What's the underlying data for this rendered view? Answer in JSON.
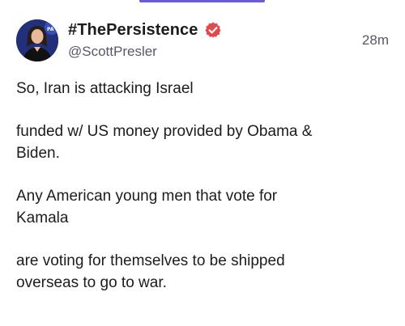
{
  "post": {
    "author": {
      "display_name": "#ThePersistence",
      "handle": "@ScottPresler",
      "verified": true,
      "avatar_icon": "profile-photo"
    },
    "timestamp": "28m",
    "paragraphs": [
      "So, Iran is attacking Israel",
      "funded w/ US money provided by Obama &\nBiden.",
      "Any American young men that vote for\nKamala",
      "are voting for themselves to be shipped\noverseas to go to war."
    ]
  },
  "colors": {
    "accent": "#6a5bd6",
    "verified_badge": "#e5484d",
    "secondary_text": "#555a63"
  }
}
